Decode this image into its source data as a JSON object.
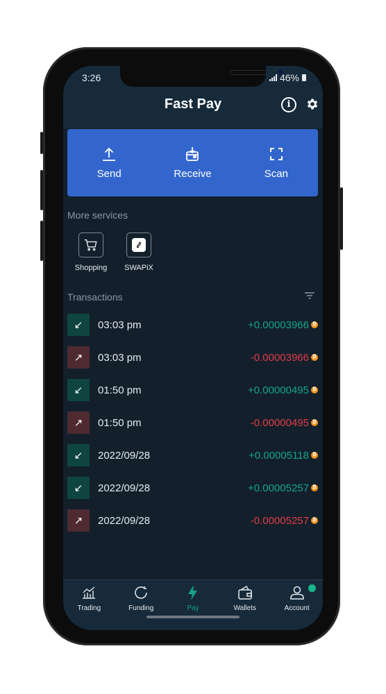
{
  "status_bar": {
    "time": "3:26",
    "battery": "46%"
  },
  "header": {
    "title": "Fast Pay",
    "info_icon": "info-icon",
    "settings_icon": "gear-icon"
  },
  "actions": [
    {
      "label": "Send",
      "icon": "upload-icon"
    },
    {
      "label": "Receive",
      "icon": "receive-wallet-icon"
    },
    {
      "label": "Scan",
      "icon": "scan-icon"
    }
  ],
  "services": {
    "heading": "More services",
    "items": [
      {
        "label": "Shopping",
        "icon": "cart-icon"
      },
      {
        "label": "SWAPiX",
        "icon": "swap-icon"
      }
    ]
  },
  "transactions": {
    "heading": "Transactions",
    "filter_icon": "filter-icon",
    "items": [
      {
        "direction": "in",
        "date": "03:03 pm",
        "amount": "+0.00003966"
      },
      {
        "direction": "out",
        "date": "03:03 pm",
        "amount": "-0.00003966"
      },
      {
        "direction": "in",
        "date": "01:50 pm",
        "amount": "+0.00000495"
      },
      {
        "direction": "out",
        "date": "01:50 pm",
        "amount": "-0.00000495"
      },
      {
        "direction": "in",
        "date": "2022/09/28",
        "amount": "+0.00005118"
      },
      {
        "direction": "in",
        "date": "2022/09/28",
        "amount": "+0.00005257"
      },
      {
        "direction": "out",
        "date": "2022/09/28",
        "amount": "-0.00005257"
      }
    ],
    "coin_symbol": "₿"
  },
  "nav": {
    "items": [
      {
        "label": "Trading",
        "icon": "chart-icon"
      },
      {
        "label": "Funding",
        "icon": "refresh-icon"
      },
      {
        "label": "Pay",
        "icon": "lightning-icon",
        "active": true
      },
      {
        "label": "Wallets",
        "icon": "wallet-icon"
      },
      {
        "label": "Account",
        "icon": "user-icon",
        "badge": true
      }
    ]
  },
  "colors": {
    "accent": "#3366cc",
    "positive": "#16a38a",
    "negative": "#e23b47",
    "coin": "#f7931a"
  }
}
